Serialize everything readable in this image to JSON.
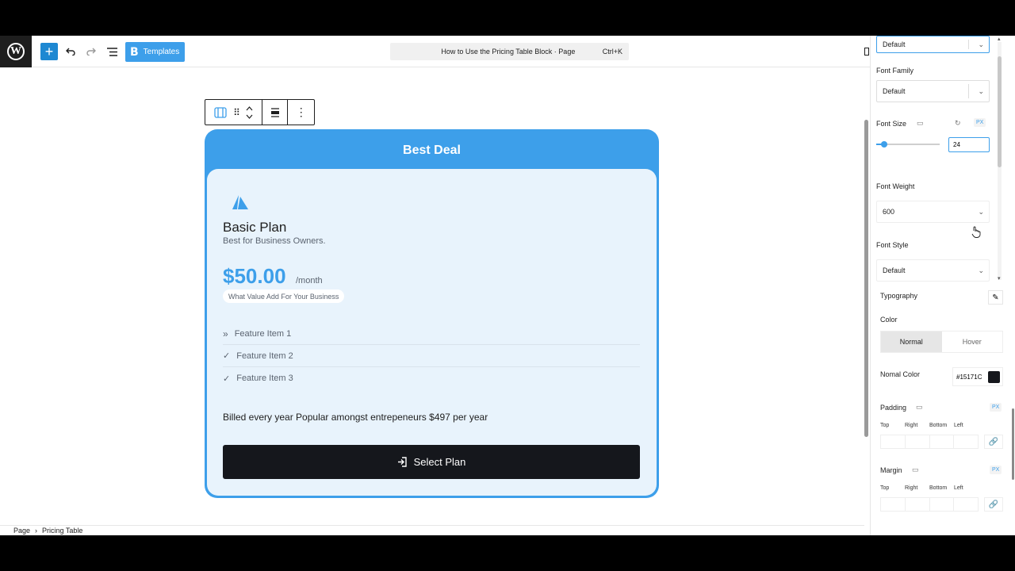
{
  "toolbar": {
    "templates_label": "Templates",
    "doc_title": "How to Use the Pricing Table Block · Page",
    "shortcut": "Ctrl+K"
  },
  "card": {
    "banner": "Best Deal",
    "plan_name": "Basic Plan",
    "plan_sub": "Best for Business Owners.",
    "price": "$50.00",
    "per": "/month",
    "value_note": "What Value Add For Your Business",
    "features": [
      "Feature Item 1",
      "Feature Item 2",
      "Feature Item 3"
    ],
    "billed": "Billed every year Popular amongst entrepeneurs $497 per year",
    "button": "Select Plan"
  },
  "breadcrumb": {
    "page": "Page",
    "block": "Pricing Table"
  },
  "sidebar": {
    "top_select": "Default",
    "font_family_label": "Font Family",
    "font_family": "Default",
    "font_size_label": "Font Size",
    "font_size_unit": "PX",
    "font_size_value": "24",
    "font_weight_label": "Font Weight",
    "font_weight": "600",
    "font_style_label": "Font Style",
    "font_style": "Default",
    "typography_label": "Typography",
    "color_label": "Color",
    "tab_normal": "Normal",
    "tab_hover": "Hover",
    "normal_color_label": "Nomal Color",
    "normal_color_value": "#15171C",
    "padding_label": "Padding",
    "margin_label": "Margin",
    "unit_px": "PX",
    "side_top": "Top",
    "side_right": "Right",
    "side_bottom": "Bottom",
    "side_left": "Left"
  },
  "colors": {
    "accent": "#3d9fea",
    "dark": "#15171c",
    "card_bg": "#e8f3fc"
  }
}
